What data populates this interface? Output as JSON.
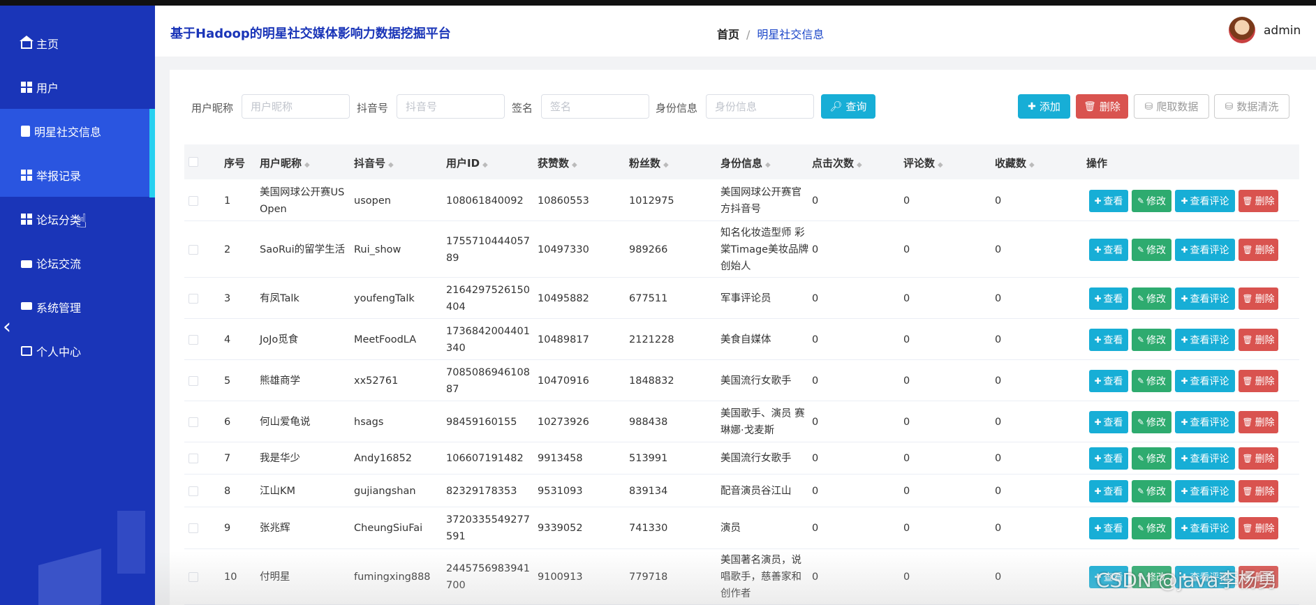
{
  "app": {
    "title": "基于Hadoop的明星社交媒体影响力数据挖掘平台"
  },
  "breadcrumb": {
    "home": "首页",
    "separator": "/",
    "current": "明星社交信息"
  },
  "user": {
    "name": "admin"
  },
  "sidebar": {
    "items": [
      {
        "label": "主页",
        "icon": "home-icon"
      },
      {
        "label": "用户",
        "icon": "grid-icon"
      },
      {
        "label": "明星社交信息",
        "icon": "clipboard-icon",
        "active": true
      },
      {
        "label": "举报记录",
        "icon": "grid-icon"
      },
      {
        "label": "论坛分类",
        "icon": "grid-icon"
      },
      {
        "label": "论坛交流",
        "icon": "briefcase-icon"
      },
      {
        "label": "系统管理",
        "icon": "monitor-icon"
      },
      {
        "label": "个人中心",
        "icon": "card-icon"
      }
    ],
    "collapse_glyph": "‹"
  },
  "search": {
    "nickname_label": "用户昵称",
    "nickname_placeholder": "用户昵称",
    "douyin_label": "抖音号",
    "douyin_placeholder": "抖音号",
    "sign_label": "签名",
    "sign_placeholder": "签名",
    "identity_label": "身份信息",
    "identity_placeholder": "身份信息",
    "query_label": "查询"
  },
  "toolbar": {
    "add_label": "添加",
    "delete_label": "删除",
    "crawl_label": "爬取数据",
    "clean_label": "数据清洗"
  },
  "table": {
    "headers": [
      "序号",
      "用户昵称",
      "抖音号",
      "用户ID",
      "获赞数",
      "粉丝数",
      "身份信息",
      "点击次数",
      "评论数",
      "收藏数",
      "操作"
    ],
    "action_labels": {
      "view": "查看",
      "edit": "修改",
      "comments": "查看评论",
      "delete": "删除"
    },
    "rows": [
      [
        "1",
        "美国网球公开赛US Open",
        "usopen",
        "108061840092",
        "10860553",
        "1012975",
        "美国网球公开赛官方抖音号",
        "0",
        "0",
        "0"
      ],
      [
        "2",
        "SaoRui的留学生活",
        "Rui_show",
        "175571044405789",
        "10497330",
        "989266",
        "知名化妆造型师 彩棠Timage美妆品牌创始人",
        "0",
        "0",
        "0"
      ],
      [
        "3",
        "有凤Talk",
        "youfengTalk",
        "2164297526150404",
        "10495882",
        "677511",
        "军事评论员",
        "0",
        "0",
        "0"
      ],
      [
        "4",
        "JoJo觅食",
        "MeetFoodLA",
        "1736842004401340",
        "10489817",
        "2121228",
        "美食自媒体",
        "0",
        "0",
        "0"
      ],
      [
        "5",
        "熊雄商学",
        "xx52761",
        "708508694610887",
        "10470916",
        "1848832",
        "美国流行女歌手",
        "0",
        "0",
        "0"
      ],
      [
        "6",
        "何山爱龟说",
        "hsags",
        "98459160155",
        "10273926",
        "988438",
        "美国歌手、演员 赛琳娜·戈麦斯",
        "0",
        "0",
        "0"
      ],
      [
        "7",
        "我是华少",
        "Andy16852",
        "106607191482",
        "9913458",
        "513991",
        "美国流行女歌手",
        "0",
        "0",
        "0"
      ],
      [
        "8",
        "江山KM",
        "gujiangshan",
        "82329178353",
        "9531093",
        "839134",
        "配音演员谷江山",
        "0",
        "0",
        "0"
      ],
      [
        "9",
        "张兆辉",
        "CheungSiuFai",
        "3720335549277591",
        "9339052",
        "741330",
        "演员",
        "0",
        "0",
        "0"
      ],
      [
        "10",
        "付明星",
        "fumingxing888",
        "2445756983941700",
        "9100913",
        "779718",
        "美国著名演员，说唱歌手，慈善家和创作者",
        "0",
        "0",
        "0"
      ]
    ]
  },
  "watermark": "CSDN @java李杨勇"
}
